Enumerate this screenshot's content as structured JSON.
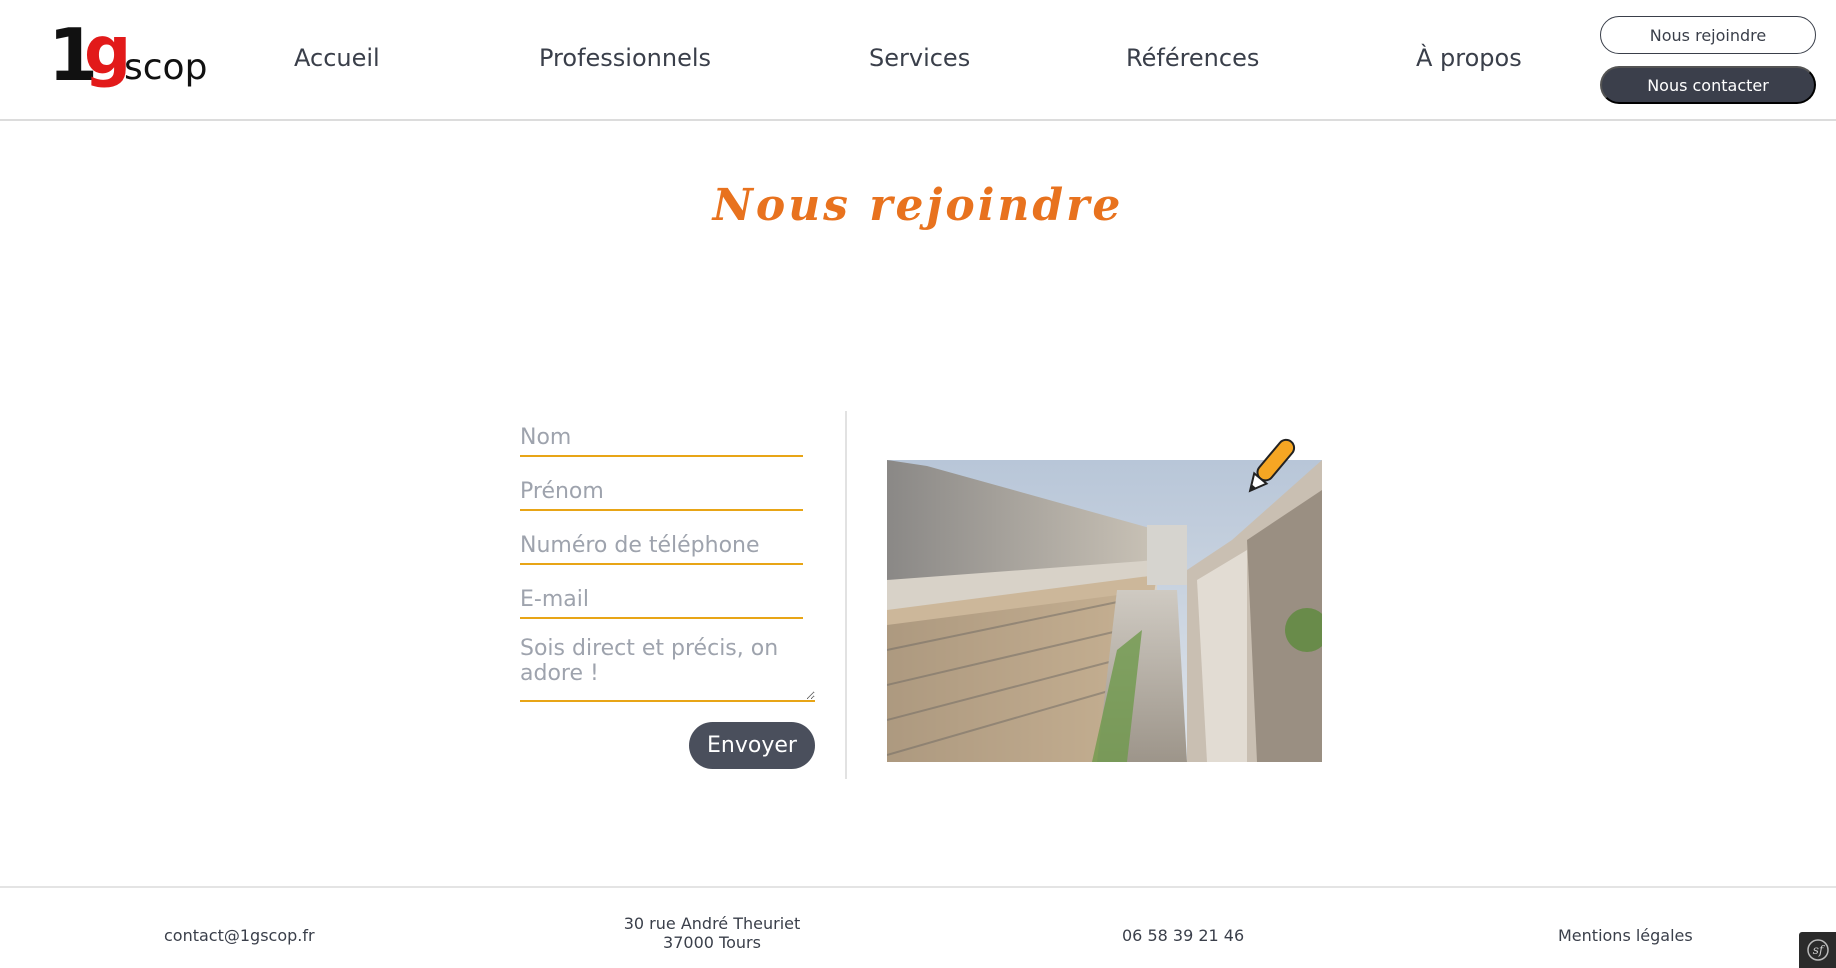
{
  "header": {
    "logo": {
      "one": "1",
      "g": "g",
      "scop": "scop"
    },
    "nav": [
      {
        "label": "Accueil"
      },
      {
        "label": "Professionnels"
      },
      {
        "label": "Services"
      },
      {
        "label": "Références"
      },
      {
        "label": "À propos"
      }
    ],
    "join_label": "Nous rejoindre",
    "contact_label": "Nous contacter"
  },
  "main": {
    "title": "Nous rejoindre",
    "form": {
      "nom_placeholder": "Nom",
      "prenom_placeholder": "Prénom",
      "phone_placeholder": "Numéro de téléphone",
      "email_placeholder": "E-mail",
      "message_placeholder": "Sois direct et précis, on adore !",
      "submit_label": "Envoyer"
    }
  },
  "footer": {
    "email": "contact@1gscop.fr",
    "address_line1": "30 rue André Theuriet",
    "address_line2": "37000 Tours",
    "phone": "06 58 39 21 46",
    "legal": "Mentions légales"
  },
  "colors": {
    "accent_orange": "#e8721e",
    "field_underline": "#e8a516",
    "dark_button": "#3b3f4b",
    "logo_red": "#e21a1a"
  }
}
